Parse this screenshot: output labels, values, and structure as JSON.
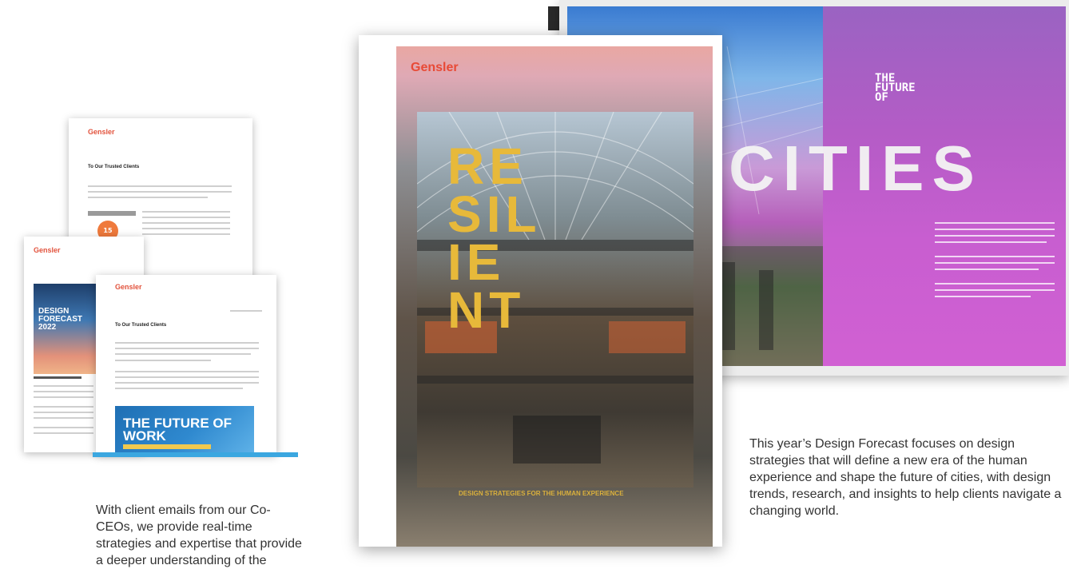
{
  "emails": {
    "logo": "Gensler",
    "card1_heading": "To Our Trusted Clients",
    "card1_badge": "15",
    "card3_heading": "To Our Trusted Clients",
    "card2_forecast": "DESIGN FORECAST 2022",
    "future_of_work": "THE FUTURE OF WORK",
    "caption": "With client emails from our Co-CEOs, we provide real-time strategies and expertise that provide a deeper understanding of the"
  },
  "cover": {
    "logo": "Gensler",
    "title_lines": [
      "RE",
      "SIL",
      "IE",
      "NT"
    ],
    "subtitle": "DESIGN STRATEGIES FOR THE HUMAN EXPERIENCE"
  },
  "spread": {
    "future_of": "THE FUTURE OF",
    "cities": "CITIES"
  },
  "forecast_caption": "This year’s Design Forecast focuses on design strategies that will define a new era of the human experience and shape the future of cities, with design trends, research, and insights to help clients navigate a changing world."
}
